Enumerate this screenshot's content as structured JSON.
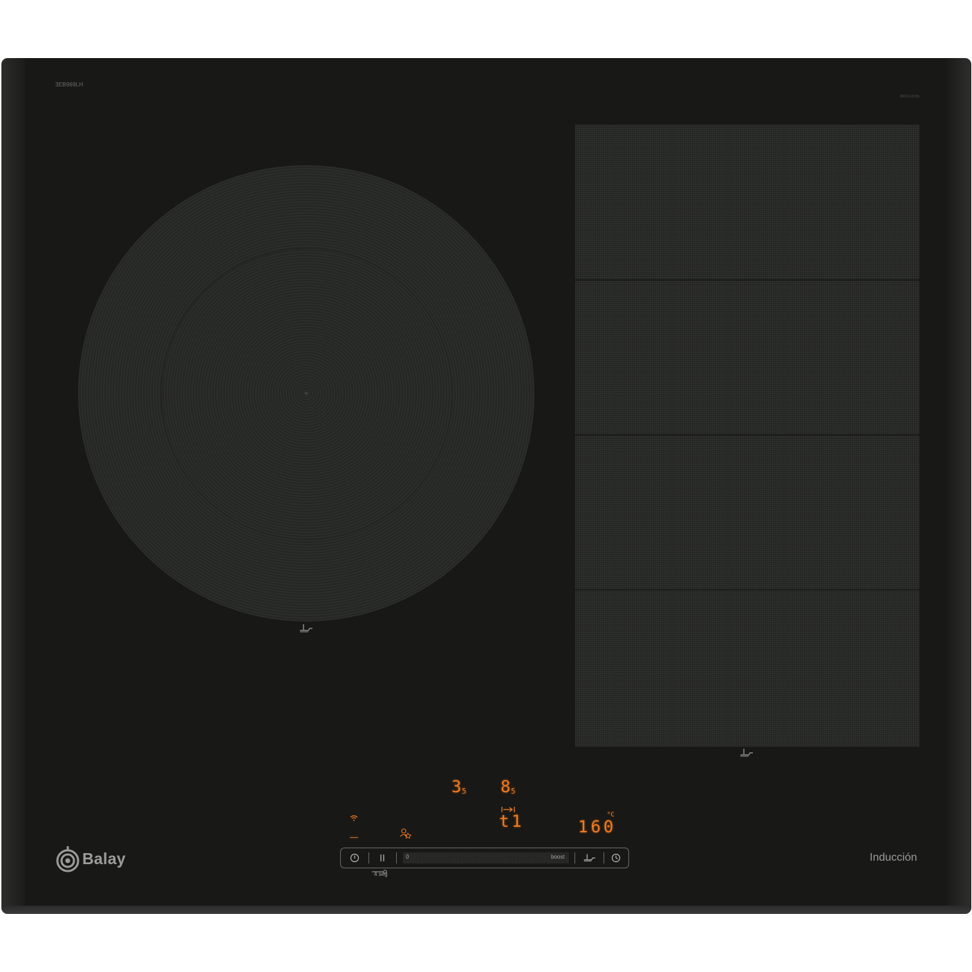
{
  "hob": {
    "model": "3EB969LH",
    "serial": "8001012155"
  },
  "zones": {
    "round": {
      "name": "round-induction-zone",
      "icon": "pan-sensor-icon"
    },
    "flex": {
      "name": "flex-induction-zone",
      "icon": "pan-sensor-icon"
    }
  },
  "display": {
    "power_left_main": "3",
    "power_left_sub": "5",
    "power_right_main": "8",
    "power_right_sub": "5",
    "timer_symbol": "t",
    "timer_value": "1",
    "temperature_value": "160",
    "temperature_unit": "°C",
    "dash": "_"
  },
  "brand": {
    "name": "Balay",
    "type_label": "Inducción"
  },
  "controls": {
    "slider_min": "0",
    "slider_max": "boost",
    "lock_hold": "4 seg"
  },
  "colors": {
    "display": "#f07a1e",
    "glass": "#181816",
    "frame": "#2c2c2c",
    "label": "#9c9c98"
  }
}
